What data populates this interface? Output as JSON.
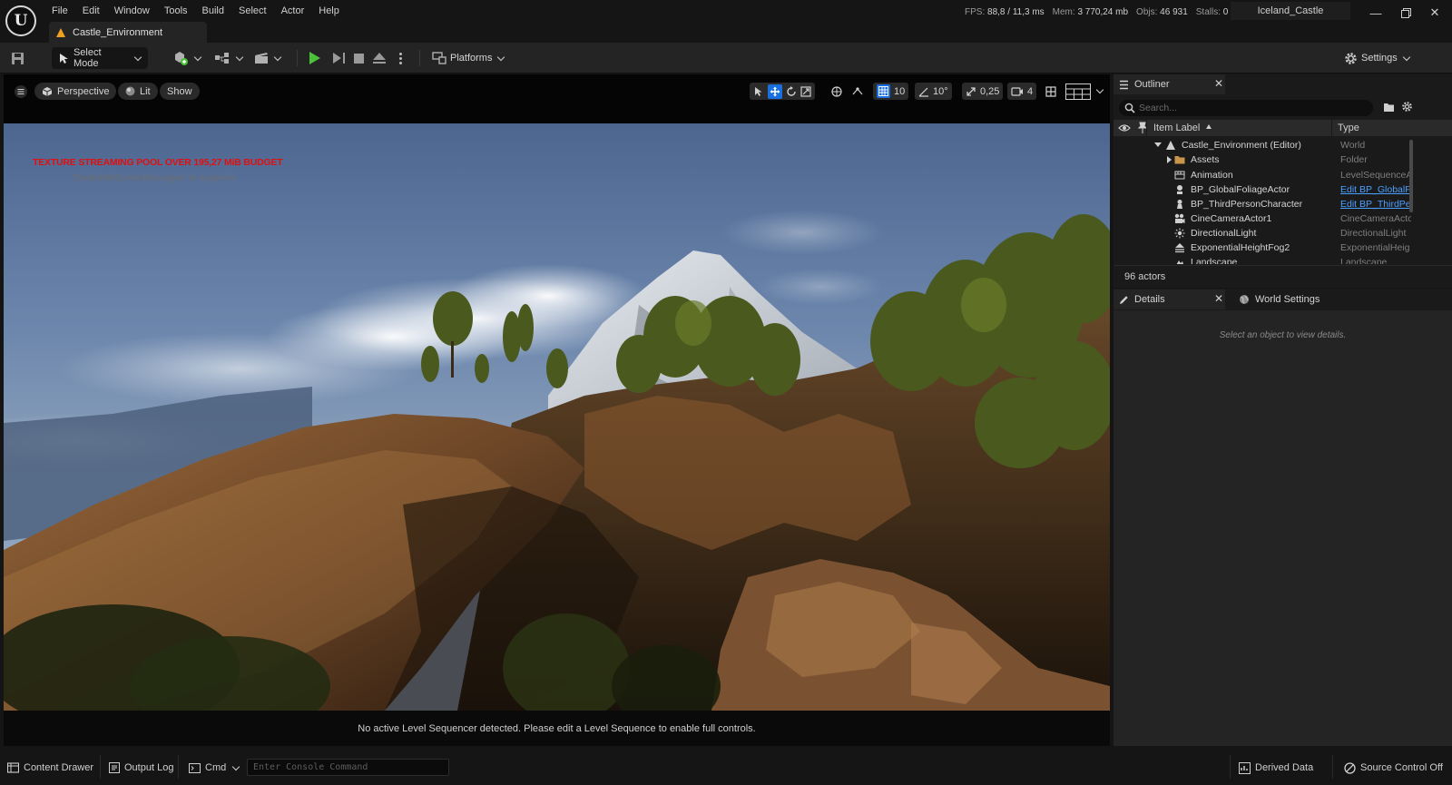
{
  "menu": [
    "File",
    "Edit",
    "Window",
    "Tools",
    "Build",
    "Select",
    "Actor",
    "Help"
  ],
  "document_tab": "Castle_Environment",
  "stats": {
    "fps_label": "FPS:",
    "fps_value": "88,8 / 11,3 ms",
    "mem_label": "Mem:",
    "mem_value": "3 770,24 mb",
    "objs_label": "Objs:",
    "objs_value": "46 931",
    "stalls_label": "Stalls:",
    "stalls_value": "0"
  },
  "project_name": "Iceland_Castle",
  "toolbar": {
    "select_mode": "Select Mode",
    "platforms": "Platforms",
    "settings": "Settings"
  },
  "viewport": {
    "perspective": "Perspective",
    "lit": "Lit",
    "show": "Show",
    "grid_snap": "10",
    "rotation_snap": "10°",
    "scale_snap": "0,25",
    "camera_speed": "4",
    "texture_warning": "TEXTURE STREAMING POOL OVER 195,27 MiB BUDGET",
    "texture_hint": "'DisableAllScreenMessages' to suppress",
    "sequencer_message": "No active Level Sequencer detected. Please edit a Level Sequence to enable full controls."
  },
  "outliner": {
    "tab_label": "Outliner",
    "search_placeholder": "Search...",
    "col_label": "Item Label",
    "col_type": "Type",
    "rows": [
      {
        "name": "Castle_Environment (Editor)",
        "type": "World"
      },
      {
        "name": "Assets",
        "type": "Folder"
      },
      {
        "name": "Animation",
        "type": "LevelSequenceA"
      },
      {
        "name": "BP_GlobalFoliageActor",
        "type": "Edit BP_GlobalF"
      },
      {
        "name": "BP_ThirdPersonCharacter",
        "type": "Edit BP_ThirdPe"
      },
      {
        "name": "CineCameraActor1",
        "type": "CineCameraActo"
      },
      {
        "name": "DirectionalLight",
        "type": "DirectionalLight"
      },
      {
        "name": "ExponentialHeightFog2",
        "type": "ExponentialHeig"
      },
      {
        "name": "Landscape",
        "type": "Landscape"
      }
    ],
    "actor_count": "96 actors"
  },
  "details": {
    "tab_label": "Details",
    "world_settings_label": "World Settings",
    "empty_message": "Select an object to view details."
  },
  "statusbar": {
    "content_drawer": "Content Drawer",
    "output_log": "Output Log",
    "cmd": "Cmd",
    "console_placeholder": "Enter Console Command",
    "derived_data": "Derived Data",
    "source_control": "Source Control Off"
  },
  "colors": {
    "play_green": "#4ec13a",
    "warning_red": "#e01010",
    "link_blue": "#4aa0ff",
    "accent_blue": "#1a6fe0"
  }
}
